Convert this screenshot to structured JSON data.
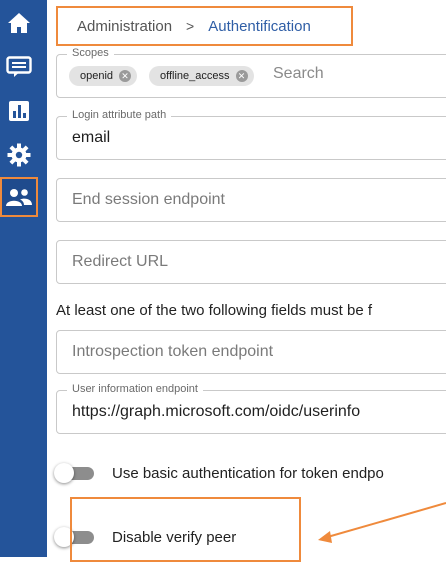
{
  "sidebar": {
    "items": [
      {
        "icon": "home-icon",
        "active": false
      },
      {
        "icon": "messages-icon",
        "active": false
      },
      {
        "icon": "chart-icon",
        "active": false
      },
      {
        "icon": "gear-icon",
        "active": false
      },
      {
        "icon": "users-icon",
        "active": true
      }
    ],
    "bg_color": "#24549a"
  },
  "breadcrumb": {
    "parent": "Administration",
    "separator": ">",
    "current": "Authentification"
  },
  "form": {
    "scopes": {
      "label": "Scopes",
      "chips": [
        "openid",
        "offline_access"
      ],
      "search_placeholder": "Search"
    },
    "login_attribute_path": {
      "label": "Login attribute path",
      "value": "email"
    },
    "end_session_endpoint": {
      "placeholder": "End session endpoint"
    },
    "redirect_url": {
      "placeholder": "Redirect URL"
    },
    "note": "At least one of the two following fields must be f",
    "introspection_token_endpoint": {
      "placeholder": "Introspection token endpoint"
    },
    "user_information_endpoint": {
      "label": "User information endpoint",
      "value": "https://graph.microsoft.com/oidc/userinfo"
    },
    "basic_auth_toggle": {
      "label": "Use basic authentication for token endpo",
      "enabled": false
    },
    "disable_verify_peer_toggle": {
      "label": "Disable verify peer",
      "enabled": false
    }
  },
  "annotation_color": "#ef8a3c"
}
